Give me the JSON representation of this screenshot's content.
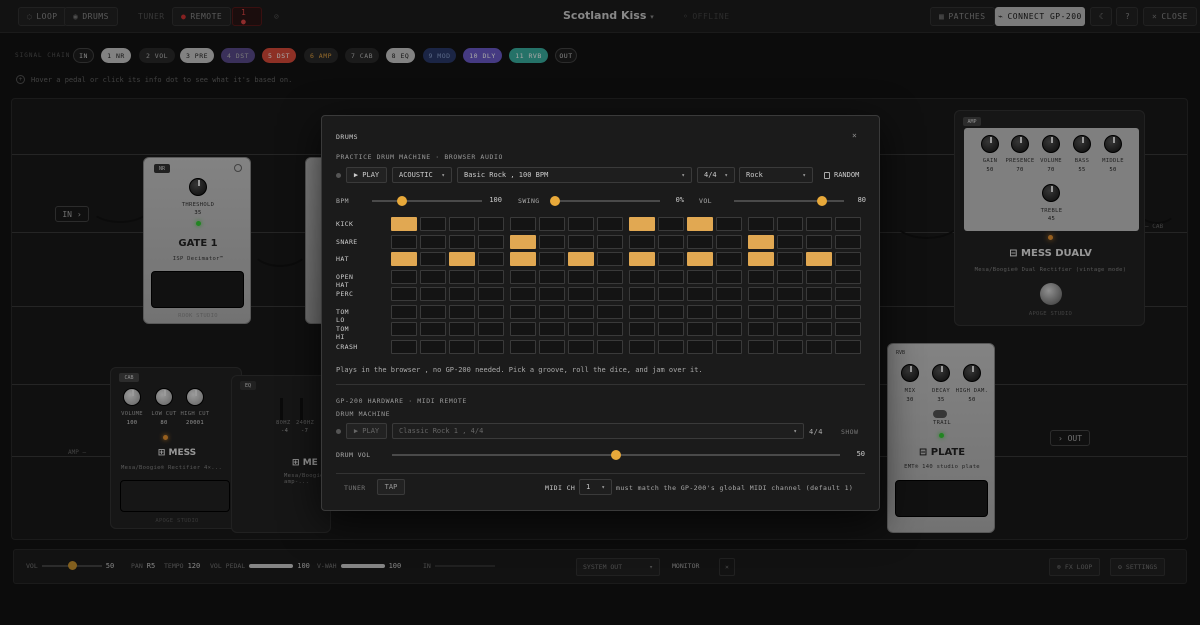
{
  "topbar": {
    "loop": "LOOP",
    "drums": "DRUMS",
    "tuner": "TUNER",
    "remote": "REMOTE",
    "title": "Scotland Kiss",
    "status": "OFFLINE",
    "patches": "PATCHES",
    "connect": "CONNECT GP-200",
    "close": "CLOSE"
  },
  "chain": {
    "label": "SIGNAL CHAIN",
    "items": [
      {
        "label": "IN",
        "color": "#1e1e1e",
        "text_color": "#ccc"
      },
      {
        "label": "1 NR",
        "color": "#c8c8c8",
        "text_color": "#222"
      },
      {
        "label": "2 VOL",
        "color": "#2a2a2a",
        "text_color": "#bbb"
      },
      {
        "label": "3 PRE",
        "color": "#c8c8c8",
        "text_color": "#222"
      },
      {
        "label": "4 DST",
        "color": "#5a4a8a",
        "text_color": "#bbb"
      },
      {
        "label": "5 DST",
        "color": "#d94a3a",
        "text_color": "#fff"
      },
      {
        "label": "6 AMP",
        "color": "#2a2a2a",
        "text_color": "#e0a040"
      },
      {
        "label": "7 CAB",
        "color": "#2a2a2a",
        "text_color": "#bbb"
      },
      {
        "label": "8 EQ",
        "color": "#c8c8c8",
        "text_color": "#222"
      },
      {
        "label": "9 MOD",
        "color": "#2a3a6a",
        "text_color": "#8aa0d0"
      },
      {
        "label": "10 DLY",
        "color": "#6a5ac8",
        "text_color": "#fff"
      },
      {
        "label": "11 RVB",
        "color": "#3ab0a0",
        "text_color": "#fff"
      },
      {
        "label": "OUT",
        "color": "#1e1e1e",
        "text_color": "#ccc"
      }
    ],
    "hint": "Hover a pedal or click its info dot to see what it's based on."
  },
  "board": {
    "in_label": "IN",
    "out_label": "OUT",
    "amp_label": "AMP",
    "cab_label": "CAB",
    "gate": {
      "tag": "NR",
      "knob": "THRESHOLD",
      "value": "35",
      "name": "GATE 1",
      "desc": "ISP Decimator™",
      "brand": "ROOK STUDIO"
    },
    "mess_dualv": {
      "tag": "AMP",
      "knobs": [
        "GAIN",
        "PRESENCE",
        "VOLUME",
        "BASS",
        "MIDDLE"
      ],
      "values": [
        "50",
        "70",
        "70",
        "55",
        "50"
      ],
      "treble": "TREBLE",
      "treble_value": "45",
      "name": "MESS DUALV",
      "desc": "Mesa/Boogie® Dual Rectifier (vintage mode)",
      "brand": "APOGE STUDIO"
    },
    "mess": {
      "tag": "CAB",
      "knobs": [
        "VOLUME",
        "LOW CUT",
        "HIGH CUT"
      ],
      "values": [
        "100",
        "80",
        "20001"
      ],
      "name": "MESS",
      "desc": "Mesa/Boogie® Rectifier 4×...",
      "brand": "APOGE STUDIO"
    },
    "eq": {
      "tag": "EQ",
      "bands": [
        "80HZ",
        "240HZ",
        "750HZ"
      ],
      "values": [
        "-4",
        "-7",
        ""
      ],
      "name": "ME",
      "desc": "Mesa/Boogie® amp-..."
    },
    "plate": {
      "tag": "RVB",
      "knobs": [
        "MIX",
        "DECAY",
        "HIGH DAM."
      ],
      "values": [
        "30",
        "35",
        "50"
      ],
      "trail": "TRAIL",
      "name": "PLATE",
      "desc": "EMT® 140 studio plate"
    }
  },
  "bottombar": {
    "vol_label": "VOL",
    "vol_value": "50",
    "pan_label": "PAN",
    "pan_value": "R5",
    "tempo_label": "TEMPO",
    "tempo_value": "120",
    "vol_pedal_label": "VOL PEDAL",
    "vol_pedal_value": "100",
    "wah_label": "V-WAH",
    "wah_value": "100",
    "in_label": "IN",
    "output": "SYSTEM OUT",
    "monitor": "MONITOR",
    "fx_loop": "FX LOOP",
    "settings": "SETTINGS"
  },
  "modal": {
    "title": "DRUMS",
    "practice_title": "PRACTICE DRUM MACHINE · BROWSER AUDIO",
    "play": "▶ PLAY",
    "kit": "ACOUSTIC",
    "groove": "Basic Rock , 100 BPM",
    "time_sig": "4/4",
    "style": "Rock",
    "random": "RANDOM",
    "bpm_label": "BPM",
    "bpm_value": "100",
    "bpm_fraction": 0.12,
    "swing_label": "SWING",
    "swing_value": "0%",
    "swing_fraction": 0.0,
    "vol_label": "VOL",
    "vol_value": "80",
    "vol_fraction": 0.8,
    "rows": [
      "KICK",
      "SNARE",
      "HAT",
      "OPEN HAT",
      "PERC",
      "TOM LO",
      "TOM HI",
      "CRASH"
    ],
    "pattern": [
      [
        1,
        0,
        0,
        0,
        0,
        0,
        0,
        0,
        1,
        0,
        1,
        0,
        0,
        0,
        0,
        0
      ],
      [
        0,
        0,
        0,
        0,
        1,
        0,
        0,
        0,
        0,
        0,
        0,
        0,
        1,
        0,
        0,
        0
      ],
      [
        1,
        0,
        1,
        0,
        1,
        0,
        1,
        0,
        1,
        0,
        1,
        0,
        1,
        0,
        1,
        0
      ],
      [
        0,
        0,
        0,
        0,
        0,
        0,
        0,
        0,
        0,
        0,
        0,
        0,
        0,
        0,
        0,
        0
      ],
      [
        0,
        0,
        0,
        0,
        0,
        0,
        0,
        0,
        0,
        0,
        0,
        0,
        0,
        0,
        0,
        0
      ],
      [
        0,
        0,
        0,
        0,
        0,
        0,
        0,
        0,
        0,
        0,
        0,
        0,
        0,
        0,
        0,
        0
      ],
      [
        0,
        0,
        0,
        0,
        0,
        0,
        0,
        0,
        0,
        0,
        0,
        0,
        0,
        0,
        0,
        0
      ],
      [
        0,
        0,
        0,
        0,
        0,
        0,
        0,
        0,
        0,
        0,
        0,
        0,
        0,
        0,
        0,
        0
      ]
    ],
    "browser_note": "Plays in the browser , no GP-200 needed. Pick a groove, roll the dice, and jam over it.",
    "hw_title": "GP-200 HARDWARE · MIDI REMOTE",
    "dm_title": "DRUM MACHINE",
    "hw_play": "▶ PLAY",
    "hw_groove": "Classic Rock 1 , 4/4",
    "hw_time_sig": "4/4",
    "hw_show": "SHOW",
    "drum_vol_label": "DRUM VOL",
    "drum_vol_value": "50",
    "drum_vol_fraction": 0.5,
    "tuner": "TUNER",
    "tap": "TAP",
    "midi_label": "MIDI CH",
    "midi_value": "1",
    "midi_note": "must match the GP-200's global MIDI channel (default 1)",
    "close": "×"
  }
}
